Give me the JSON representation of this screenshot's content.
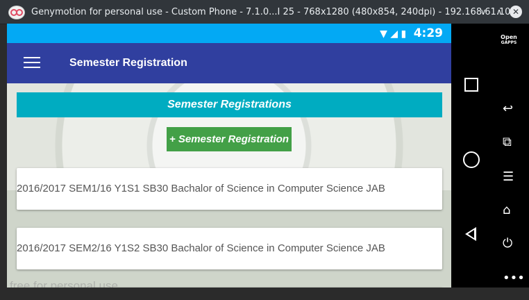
{
  "window": {
    "title": "Genymotion for personal use - Custom Phone - 7.1.0...I 25 - 768x1280 (480x854, 240dpi) - 192.168.61.101",
    "minimize": "∨",
    "maximize": "∧",
    "close": "✕"
  },
  "status_bar": {
    "time": "4:29"
  },
  "toolbar": {
    "title": "Semester Registration"
  },
  "section": {
    "header": "Semester Registrations"
  },
  "add_button": {
    "label": "+ Semester Registration"
  },
  "registrations": [
    {
      "text": "2016/2017 SEM1/16 Y1S1 SB30 Bachalor of Science in Computer Science JAB"
    },
    {
      "text": "2016/2017 SEM2/16 Y1S2 SB30 Bachalor of Science in Computer Science JAB"
    }
  ],
  "watermark": "free for personal use",
  "sidebar": {
    "opengapps_line1": "Open",
    "opengapps_line2": "GAPPS"
  },
  "colors": {
    "statusbar": "#03a9f4",
    "toolbar": "#303f9f",
    "header": "#00acc1",
    "add_button": "#43a047"
  }
}
